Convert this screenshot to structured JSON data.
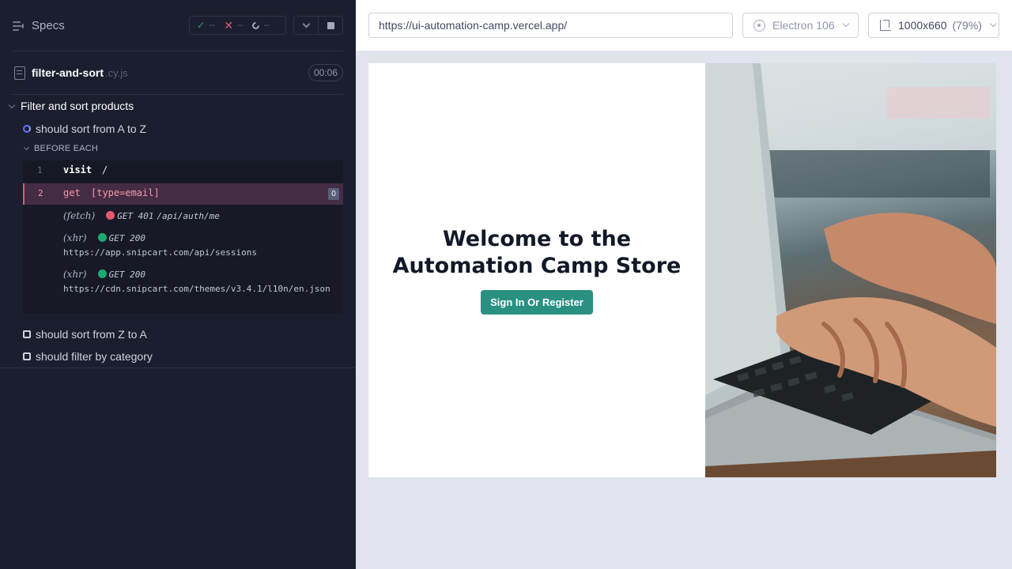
{
  "reporter": {
    "specs_label": "Specs",
    "stats": {
      "passed": "--",
      "failed": "--",
      "pending": "--"
    },
    "file": {
      "name": "filter-and-sort",
      "ext": ".cy.js",
      "duration": "00:06"
    },
    "suite": "Filter and sort products",
    "tests": [
      {
        "title": "should sort from A to Z",
        "state": "running"
      },
      {
        "title": "should sort from Z to A",
        "state": "queued"
      },
      {
        "title": "should filter by category",
        "state": "queued"
      }
    ],
    "hook_label": "BEFORE EACH",
    "commands": [
      {
        "num": "1",
        "name": "visit",
        "arg": "/"
      },
      {
        "num": "2",
        "name": "get",
        "arg": "[type=email]",
        "badge": "0"
      }
    ],
    "requests": [
      {
        "type": "(fetch)",
        "status": "GET 401",
        "url": "/api/auth/me",
        "color": "#e45770"
      },
      {
        "type": "(xhr)",
        "status": "GET 200",
        "url": "https://app.snipcart.com/api/sessions",
        "color": "#1fa971"
      },
      {
        "type": "(xhr)",
        "status": "GET 200",
        "url": "https://cdn.snipcart.com/themes/v3.4.1/l10n/en.json",
        "color": "#1fa971"
      }
    ]
  },
  "topbar": {
    "url": "https://ui-automation-camp.vercel.app/",
    "browser": "Electron 106",
    "viewport": "1000x660",
    "zoom": "(79%)"
  },
  "aut": {
    "heading": "Welcome to the Automation Camp Store",
    "button": "Sign In Or Register"
  },
  "colors": {
    "accent": "#2a9182",
    "reporter_bg": "#1b1e2e",
    "failed": "#e45770",
    "passed": "#1fa971"
  },
  "icons": {
    "specs": "list-icon",
    "file": "document-icon",
    "browser": "electron-icon",
    "viewport": "ruler-icon"
  }
}
